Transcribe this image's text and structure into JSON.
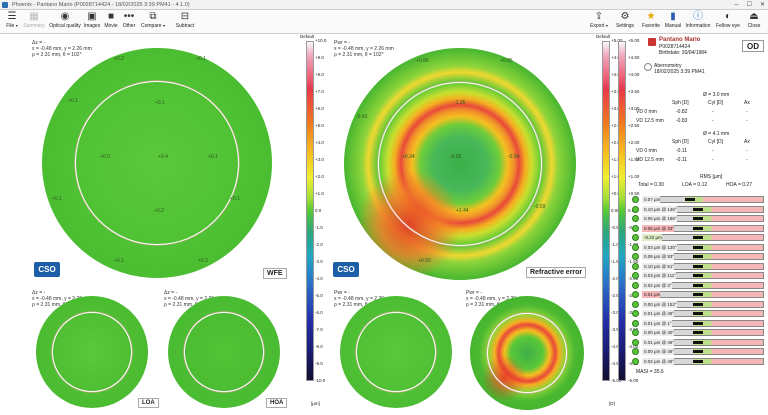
{
  "title": "Phoenix - Pantano Mario (P0028714424 - 18/02/2025 3:39 PM41 - 4.1.0)",
  "toolbar": {
    "file": "File",
    "summary": "Summary",
    "optical_quality": "Optical quality",
    "images": "Images",
    "movie": "Movie",
    "other": "Other",
    "compare": "Compare",
    "subtract": "Subtract",
    "export": "Export",
    "settings": "Settings",
    "favorite": "Favorite",
    "manual": "Manual",
    "information": "Information",
    "fellow_eye": "Fellow eye",
    "close": "Close"
  },
  "panels": {
    "wfe": {
      "label": "WFE",
      "scale_title": "Default",
      "info": [
        "Δz = -",
        "x = -0.48 mm, y = 2.26 mm",
        "ρ = 2.31 mm, θ = 102°"
      ],
      "points": [
        "+0.2",
        "+0.1",
        "+0.1",
        "+0.1",
        "+0.0",
        "-0.0",
        "+0.1",
        "+0.0",
        "+0.4",
        "+0.1",
        "+0.1",
        "+0.2",
        "+0.1",
        "+0.1",
        "+0.0",
        "+0.1",
        "+0.2",
        "+0.0"
      ]
    },
    "refr": {
      "label": "Refractive error",
      "scale_title": "Default",
      "info": [
        "Pwr = -",
        "x = -0.48 mm, y = 2.26 mm",
        "ρ = 2.31 mm, θ = 102°"
      ],
      "points": [
        "+0.86",
        "+0.85",
        "-0.43",
        "-1.26",
        "+0.34",
        "+1.90",
        "-0.62",
        "-0.94",
        "+1.40",
        "+1.44",
        "-1.48",
        "-0.59",
        "+0.50"
      ]
    },
    "wfe_loa": {
      "label": "LOA",
      "info": [
        "Δz = -",
        "x = -0.48 mm, y = 2.26 mm",
        "ρ = 2.31 mm, θ = 102°"
      ]
    },
    "wfe_hoa": {
      "label": "HOA",
      "info": [
        "Δz = -",
        "x = -0.48 mm, y = 2.26 mm",
        "ρ = 2.31 mm, θ = 102°"
      ]
    },
    "refr_loa": {
      "info": [
        "Pwr = -",
        "x = -0.48 mm, y = 2.26 mm",
        "ρ = 2.31 mm, θ = 102°"
      ]
    },
    "refr_hoa": {
      "info": [
        "Pwr = -",
        "x = -0.48 mm, y = 2.26 mm",
        "ρ = 2.31 mm, θ = 102°"
      ]
    }
  },
  "scale_wfe": {
    "labels": [
      "+10.0",
      "+9.0",
      "+8.0",
      "+7.0",
      "+6.0",
      "+5.0",
      "+4.0",
      "+3.0",
      "+2.0",
      "+1.0",
      "0.0",
      "-1.0",
      "-2.0",
      "-3.0",
      "-4.0",
      "-5.0",
      "-6.0",
      "-7.0",
      "-8.0",
      "-9.0",
      "-10.0"
    ],
    "unit": "[µm]"
  },
  "scale_refr": {
    "labels": [
      "+5.00",
      "+4.50",
      "+4.00",
      "+3.50",
      "+3.00",
      "+2.50",
      "+2.00",
      "+1.50",
      "+1.00",
      "+0.50",
      "0.00",
      "-0.50",
      "-1.00",
      "-1.50",
      "-2.00",
      "-2.50",
      "-3.00",
      "-3.50",
      "-4.00",
      "-4.50",
      "-5.00"
    ],
    "unit": "[D]"
  },
  "scale_right": {
    "labels": [
      "+5.00",
      "+4.50",
      "+4.00",
      "+3.50",
      "+3.00",
      "+2.50",
      "+2.00",
      "+1.50",
      "+1.00",
      "+0.50",
      "0.00",
      "-0.50",
      "-1.00",
      "-1.50",
      "-2.00",
      "-2.50",
      "-3.00",
      "-3.50",
      "-4.00",
      "-4.50",
      "-5.00"
    ]
  },
  "patient": {
    "name": "Pantano Mario",
    "id": "P0028714424",
    "birthdate": "Birthdate: 30/04/1984",
    "eye": "OD",
    "exam": "Aberrometry",
    "exam_date": "18/02/2025 3:39 PM41"
  },
  "refraction": {
    "d1": "Ø = 3.0 mm",
    "d2": "Ø = 4.1 mm",
    "headers": [
      "Sph [D]",
      "Cyl [D]",
      "Ax"
    ],
    "rows1": [
      [
        "VD 0 mm",
        "-0.82",
        "-",
        "-"
      ],
      [
        "VD 12.5 mm",
        "-0.83",
        "-",
        "-"
      ]
    ],
    "rows2": [
      [
        "VD 0 mm",
        "-0.11",
        "-",
        "-"
      ],
      [
        "VD 12.5 mm",
        "-0.11",
        "-",
        "-"
      ]
    ]
  },
  "rms": {
    "title": "RMS [µm]",
    "total": "Total = 0.30",
    "loa": "LOA = 0.12",
    "hoa": "HOA = 0.27"
  },
  "zernike": [
    {
      "label": "0.07 µm",
      "level": 0.35,
      "color": "#ececec"
    },
    {
      "label": "0.10 µm @ 146°",
      "level": 0.42,
      "color": "#ececec"
    },
    {
      "label": "0.06 µm @ 186°",
      "level": 0.42,
      "color": "#ececec"
    },
    {
      "label": "0.06 µm @ 33°",
      "level": 0.42,
      "color": "#f4b6b6"
    },
    {
      "label": "-0.22 µm",
      "level": 0.42,
      "color": "#dcecc4"
    },
    {
      "label": "0.03 µm @ 130°",
      "level": 0.42,
      "color": "#ececec"
    },
    {
      "label": "0.09 µm @ 93°",
      "level": 0.42,
      "color": "#ececec"
    },
    {
      "label": "0.10 µm @ 51°",
      "level": 0.42,
      "color": "#ececec"
    },
    {
      "label": "0.03 µm @ 111°",
      "level": 0.42,
      "color": "#ececec"
    },
    {
      "label": "0.02 µm @ 3°",
      "level": 0.42,
      "color": "#ececec"
    },
    {
      "label": "0.01 µm",
      "level": 0.42,
      "color": "#f4b6b6"
    },
    {
      "label": "0.00 µm @ 152°",
      "level": 0.42,
      "color": "#ececec"
    },
    {
      "label": "0.01 µm @ 49°",
      "level": 0.42,
      "color": "#ececec"
    },
    {
      "label": "0.01 µm @ 1°",
      "level": 0.42,
      "color": "#ececec"
    },
    {
      "label": "0.00 µm @ 40°",
      "level": 0.42,
      "color": "#ececec"
    },
    {
      "label": "0.01 µm @ 49°",
      "level": 0.42,
      "color": "#ececec"
    },
    {
      "label": "0.00 µm @ 49°",
      "level": 0.42,
      "color": "#ececec"
    },
    {
      "label": "0.02 µm @ 49°",
      "level": 0.42,
      "color": "#ececec"
    }
  ],
  "masi": "MASI = 35.6"
}
